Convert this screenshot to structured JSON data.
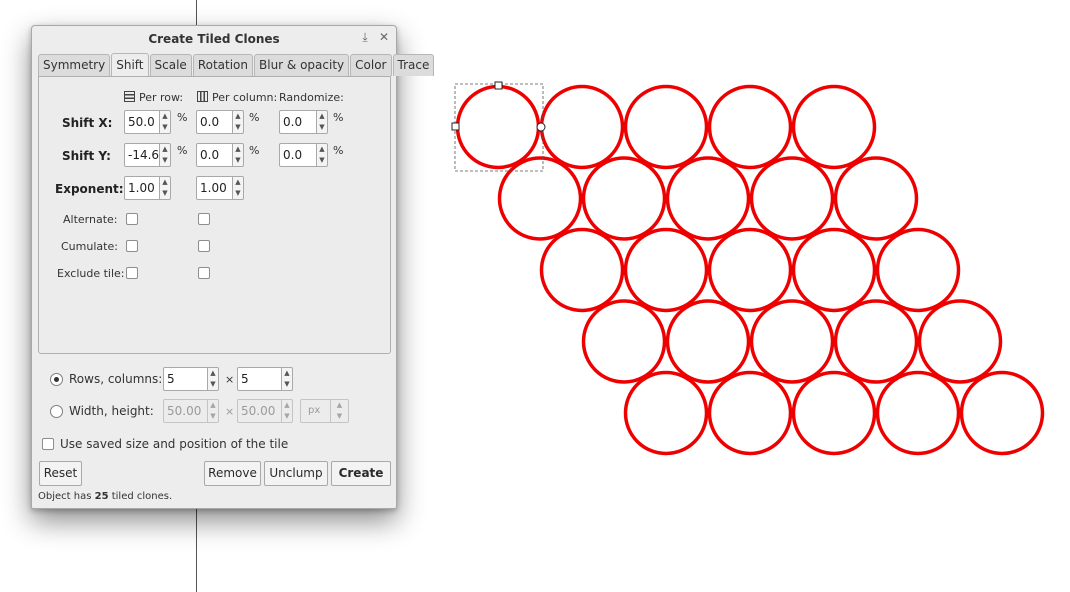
{
  "dialog": {
    "title": "Create Tiled Clones",
    "dock_icon": "dock-icon",
    "close_icon": "close-icon",
    "tabs": [
      {
        "label": "Symmetry"
      },
      {
        "label": "Shift"
      },
      {
        "label": "Scale"
      },
      {
        "label": "Rotation"
      },
      {
        "label": "Blur & opacity"
      },
      {
        "label": "Color"
      },
      {
        "label": "Trace"
      }
    ],
    "active_tab": "Shift",
    "columns": {
      "per_row": "Per row:",
      "per_column": "Per column:",
      "randomize": "Randomize:"
    },
    "shift_x": {
      "label": "Shift X:",
      "per_row": "50.0",
      "per_column": "0.0",
      "randomize": "0.0",
      "unit": "%"
    },
    "shift_y": {
      "label": "Shift Y:",
      "per_row": "-14.6",
      "per_column": "0.0",
      "randomize": "0.0",
      "unit": "%"
    },
    "exponent": {
      "label": "Exponent:",
      "per_row": "1.00",
      "per_column": "1.00"
    },
    "alternate": {
      "label": "Alternate:"
    },
    "cumulate": {
      "label": "Cumulate:"
    },
    "exclude_tile": {
      "label": "Exclude tile:"
    },
    "rows_columns": {
      "label": "Rows, columns:",
      "rows": "5",
      "columns": "5",
      "times": "×",
      "selected": true
    },
    "width_height": {
      "label": "Width, height:",
      "width": "50.00",
      "height": "50.00",
      "unit": "px",
      "times": "×",
      "selected": false
    },
    "use_saved": {
      "label": "Use saved size and position of the tile",
      "checked": false
    },
    "buttons": {
      "reset": "Reset",
      "remove": "Remove",
      "unclump": "Unclump",
      "create": "Create"
    },
    "status": {
      "prefix": "Object has ",
      "count": "25",
      "suffix": " tiled clones."
    }
  },
  "canvas": {
    "circle_color": "#ee0000",
    "rows": 5,
    "columns": 5,
    "selection": "first-circle"
  }
}
